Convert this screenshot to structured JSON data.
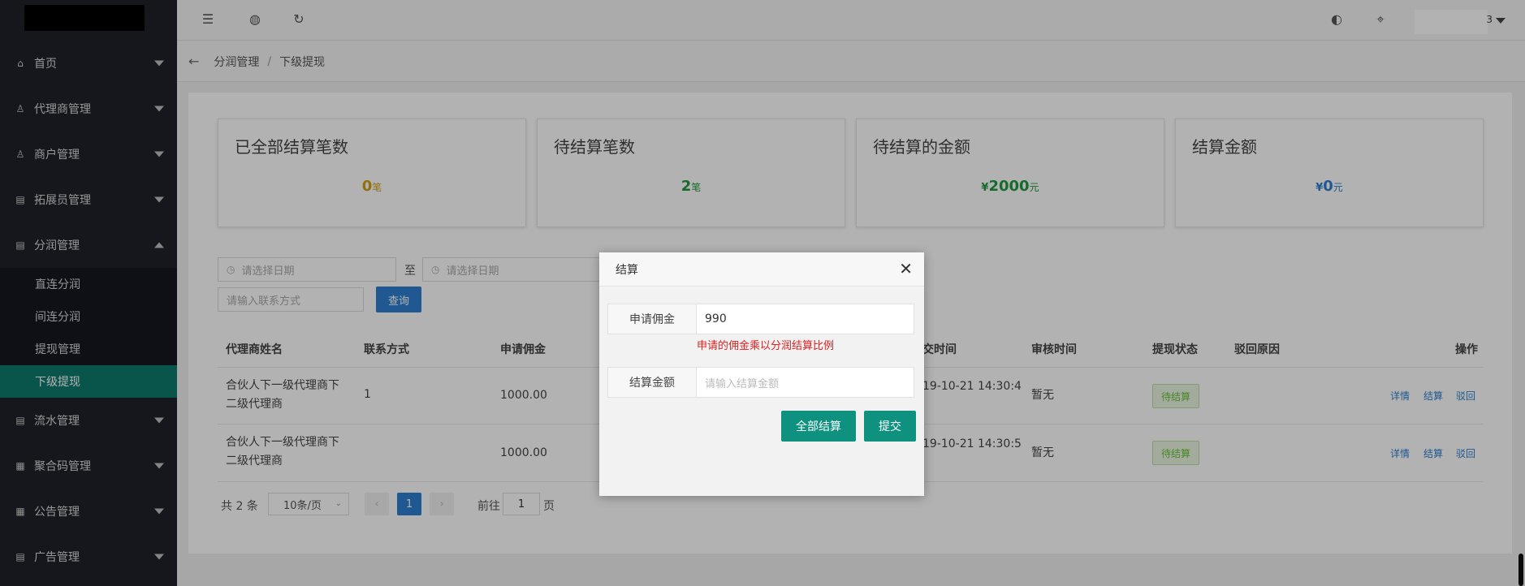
{
  "sidebar": {
    "menu": [
      {
        "label": "首页",
        "icon": "home-icon"
      },
      {
        "label": "代理商管理",
        "icon": "user-icon"
      },
      {
        "label": "商户管理",
        "icon": "user-icon"
      },
      {
        "label": "拓展员管理",
        "icon": "clipboard-icon"
      },
      {
        "label": "分润管理",
        "icon": "clipboard-icon",
        "expanded": true
      }
    ],
    "submenu": [
      "直连分润",
      "间连分润",
      "提现管理",
      "下级提现"
    ],
    "menu_after": [
      {
        "label": "流水管理",
        "icon": "clipboard-icon"
      },
      {
        "label": "聚合码管理",
        "icon": "qr-icon"
      },
      {
        "label": "公告管理",
        "icon": "qr-icon"
      },
      {
        "label": "广告管理",
        "icon": "clipboard-icon"
      }
    ],
    "active_sub": "下级提现"
  },
  "topbar": {
    "user_tail": "3"
  },
  "breadcrumb": {
    "parent": "分润管理",
    "sep": "/",
    "current": "下级提现"
  },
  "stats": [
    {
      "title": "已全部结算笔数",
      "prefix": "",
      "value": "0",
      "unit": "笔",
      "color": "#d4a017"
    },
    {
      "title": "待结算笔数",
      "prefix": "",
      "value": "2",
      "unit": "笔",
      "color": "#1f9a3e"
    },
    {
      "title": "待结算的金额",
      "prefix": "¥",
      "value": "2000",
      "unit": "元",
      "color": "#1f9a3e"
    },
    {
      "title": "结算金额",
      "prefix": "¥",
      "value": "0",
      "unit": "元",
      "color": "#2f7fd0"
    }
  ],
  "filters": {
    "date_start_placeholder": "请选择日期",
    "date_sep": "至",
    "date_end_placeholder": "请选择日期",
    "contact_placeholder": "请输入联系方式",
    "query_label": "查询"
  },
  "table": {
    "headers": [
      "代理商姓名",
      "联系方式",
      "申请佣金",
      "提交时间",
      "审核时间",
      "提现状态",
      "驳回原因",
      "操作"
    ],
    "headers_visible": [
      "代理商姓名",
      "联系方式",
      "申请佣金",
      "交时间",
      "审核时间",
      "提现状态",
      "驳回原因",
      "操作"
    ],
    "rows": [
      {
        "name_line1": "合伙人下一级代理商下",
        "name_line2": "二级代理商",
        "contact_prefix": "1",
        "amount": "1000.00",
        "submit_time": "19-10-21 14:30:4",
        "audit_time": "暂无",
        "status": "待结算",
        "ops": [
          "详情",
          "结算",
          "驳回"
        ]
      },
      {
        "name_line1": "合伙人下一级代理商下",
        "name_line2": "二级代理商",
        "contact_prefix": "",
        "amount": "1000.00",
        "submit_time": "19-10-21 14:30:5",
        "audit_time": "暂无",
        "status": "待结算",
        "ops": [
          "详情",
          "结算",
          "驳回"
        ]
      }
    ]
  },
  "pager": {
    "total": "共 2 条",
    "page_size": "10条/页",
    "prev": "‹",
    "current": "1",
    "next": "›",
    "goto_label": "前往",
    "goto_value": "1",
    "page_suffix": "页"
  },
  "modal": {
    "title": "结算",
    "close": "✕",
    "commission_label": "申请佣金",
    "commission_value": "990",
    "hint": "申请的佣金乘以分润结算比例",
    "settle_label": "结算金额",
    "settle_placeholder": "请输入结算金额",
    "settle_all_label": "全部结算",
    "submit_label": "提交"
  }
}
